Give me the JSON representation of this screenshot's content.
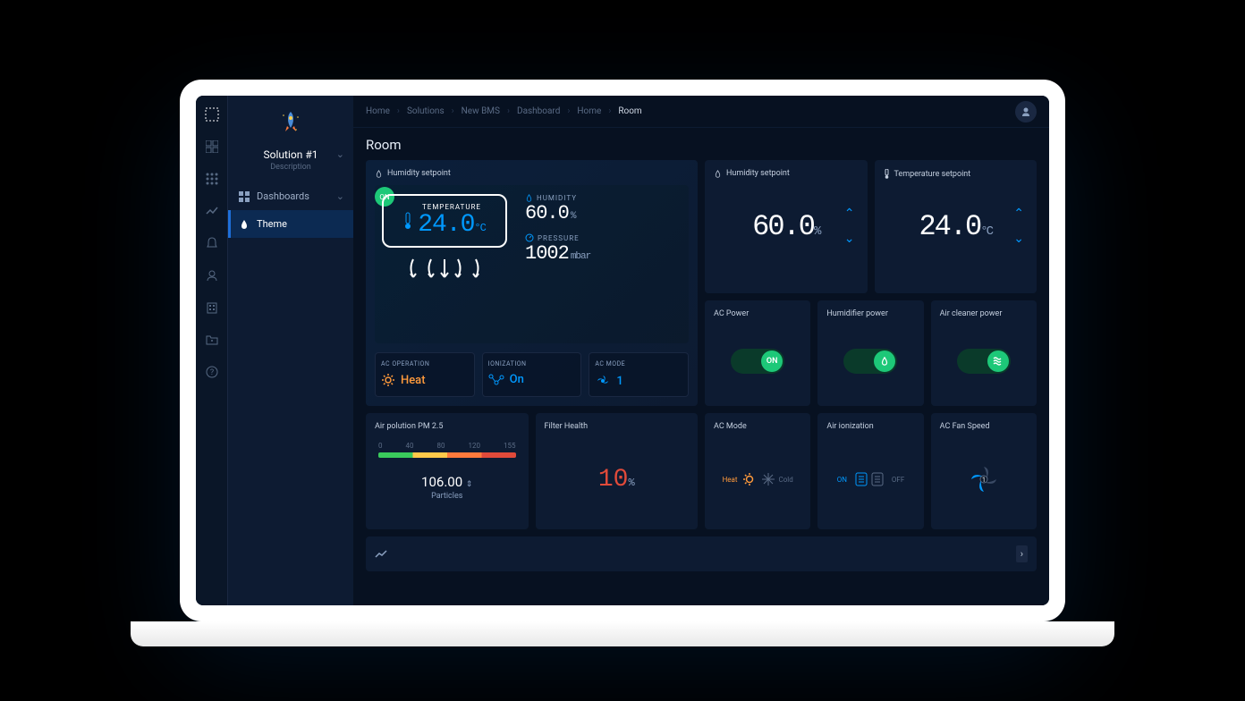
{
  "app": {
    "logo_glyph": "⬚"
  },
  "sidebar": {
    "solution_name": "Solution #1",
    "solution_desc": "Description",
    "items": [
      {
        "label": "Dashboards",
        "icon": "dashboard"
      },
      {
        "label": "Theme",
        "icon": "water-drop",
        "active": true
      }
    ]
  },
  "breadcrumb": [
    "Home",
    "Solutions",
    "New BMS",
    "Dashboard",
    "Home",
    "Room"
  ],
  "page_title": "Room",
  "hero": {
    "title": "Humidity setpoint",
    "on_badge": "ON",
    "temperature_label": "TEMPERATURE",
    "temperature_value": "24.0",
    "temperature_unit": "°C",
    "humidity_label": "HUMIDITY",
    "humidity_value": "60.0",
    "humidity_unit": "%",
    "pressure_label": "PRESSURE",
    "pressure_value": "1002",
    "pressure_unit": "mbar",
    "ac_operation_label": "AC OPERATION",
    "ac_operation_value": "Heat",
    "ionization_label": "IONIZATION",
    "ionization_value": "On",
    "ac_mode_label": "AC MODE",
    "ac_mode_value": "1"
  },
  "cards": {
    "humidity_setpoint": {
      "title": "Humidity setpoint",
      "value": "60.0",
      "unit": "%"
    },
    "temperature_setpoint": {
      "title": "Temperature setpoint",
      "value": "24.0",
      "unit": "°C"
    },
    "ac_power": {
      "title": "AC Power",
      "state": "ON"
    },
    "humidifier_power": {
      "title": "Humidifier power",
      "state": "on"
    },
    "air_cleaner_power": {
      "title": "Air cleaner power",
      "state": "on"
    },
    "pm25": {
      "title": "Air polution PM 2.5",
      "scale": [
        "0",
        "40",
        "80",
        "120",
        "155"
      ],
      "value": "106.00",
      "unit": "Particles"
    },
    "filter_health": {
      "title": "Filter Health",
      "value": "10",
      "unit": "%"
    },
    "ac_mode": {
      "title": "AC Mode",
      "heat_label": "Heat",
      "cold_label": "Cold"
    },
    "air_ionization": {
      "title": "Air ionization",
      "on_label": "ON",
      "off_label": "OFF"
    },
    "ac_fan_speed": {
      "title": "AC Fan Speed",
      "value": "1"
    }
  }
}
